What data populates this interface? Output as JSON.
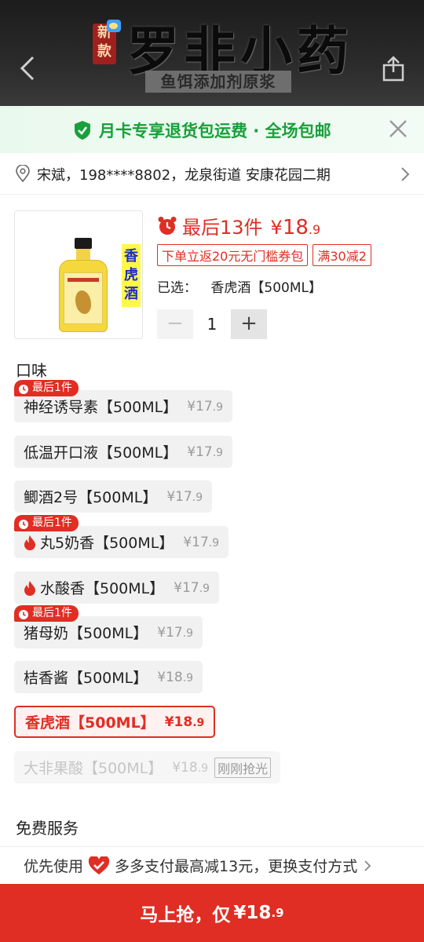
{
  "banner": {
    "new_badge": "新款",
    "title": "罗非小药",
    "subtitle": "鱼饵添加剂原浆"
  },
  "promo": {
    "text": "月卡专享退货包运费 · 全场包邮"
  },
  "address": {
    "text": "宋斌，198****8802，龙泉街道 安康花园二期"
  },
  "product": {
    "image_tag": "香虎酒",
    "price_prefix": "最后13件",
    "currency": "¥",
    "price_int": "18",
    "price_dec": ".9",
    "coupons": [
      "下单立返20元无门槛券包",
      "满30减2"
    ],
    "selected_label": "已选：",
    "selected_value": "香虎酒【500ML】",
    "quantity": "1",
    "minus": "−",
    "plus": "+"
  },
  "flavor_title": "口味",
  "last_badge_text": "最后1件",
  "options": [
    {
      "name": "神经诱导素【500ML】",
      "price": "¥17",
      "dec": ".9"
    },
    {
      "name": "低温开口液【500ML】",
      "price": "¥17",
      "dec": ".9"
    },
    {
      "name": "鲫酒2号【500ML】",
      "price": "¥17",
      "dec": ".9"
    },
    {
      "name": "丸5奶香【500ML】",
      "price": "¥17",
      "dec": ".9"
    },
    {
      "name": "水酸香【500ML】",
      "price": "¥17",
      "dec": ".9"
    },
    {
      "name": "猪母奶【500ML】",
      "price": "¥17",
      "dec": ".9"
    },
    {
      "name": "桔香酱【500ML】",
      "price": "¥18",
      "dec": ".9"
    },
    {
      "name": "香虎酒【500ML】",
      "price": "¥18",
      "dec": ".9"
    },
    {
      "name": "大非果酸【500ML】",
      "price": "¥18",
      "dec": ".9",
      "tag": "刚刚抢光"
    }
  ],
  "service_title": "免费服务",
  "pay": {
    "lead": "优先使用",
    "text": "多多支付最高减13元，更换支付方式"
  },
  "buy": {
    "label": "马上抢，仅",
    "price": "¥18",
    "dec": ".9"
  },
  "colors": {
    "brand_red": "#e02e24",
    "promo_green": "#18a03b"
  }
}
